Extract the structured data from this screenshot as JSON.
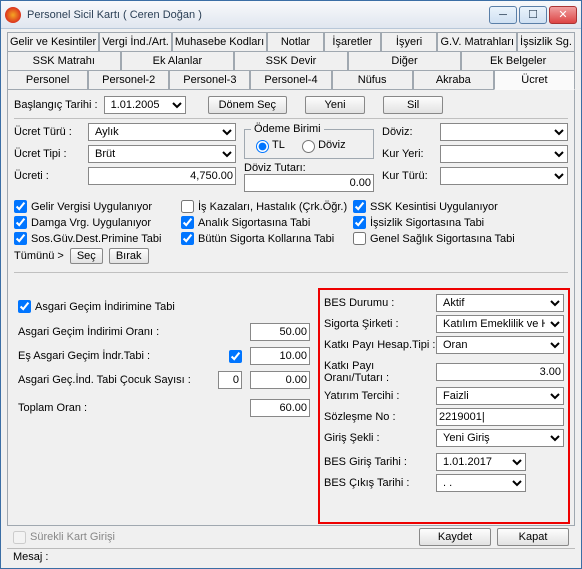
{
  "window": {
    "title": "Personel Sicil Kartı ( Ceren Doğan )"
  },
  "tabs": {
    "row1": [
      "Gelir ve Kesintiler",
      "Vergi İnd./Art.",
      "Muhasebe Kodları",
      "Notlar",
      "İşaretler",
      "İşyeri",
      "G.V. Matrahları",
      "İşsizlik Sg."
    ],
    "row2": [
      "SSK Matrahı",
      "Ek Alanlar",
      "SSK Devir",
      "Diğer",
      "Ek Belgeler"
    ],
    "row3": [
      "Personel",
      "Personel-2",
      "Personel-3",
      "Personel-4",
      "Nüfus",
      "Akraba",
      "Ücret"
    ]
  },
  "toprow": {
    "baslangic_label": "Başlangıç Tarihi :",
    "baslangic_value": "1.01.2005",
    "donem_sec": "Dönem Seç",
    "yeni": "Yeni",
    "sil": "Sil"
  },
  "ucret": {
    "turu_label": "Ücret Türü :",
    "turu_value": "Aylık",
    "tipi_label": "Ücret Tipi :",
    "tipi_value": "Brüt",
    "ucreti_label": "Ücreti :",
    "ucreti_value": "4,750.00",
    "odeme_legend": "Ödeme Birimi",
    "tl": "TL",
    "doviz": "Döviz",
    "doviz_tutari_label": "Döviz Tutarı:",
    "doviz_tutari_value": "0.00",
    "doviz_label": "Döviz:",
    "kur_yeri_label": "Kur Yeri:",
    "kur_turu_label": "Kur Türü:"
  },
  "checks": {
    "gelir_vergisi": "Gelir Vergisi Uygulanıyor",
    "is_kazalari": "İş Kazaları, Hastalık (Çrk.Öğr.)",
    "ssk_kesintisi": "SSK Kesintisi Uygulanıyor",
    "damga": "Damga Vrg. Uygulanıyor",
    "analik": "Analık Sigortasına Tabi",
    "issizlik": "İşsizlik Sigortasına Tabi",
    "sosguv": "Sos.Güv.Dest.Primine Tabi",
    "butun": "Bütün Sigorta Kollarına Tabi",
    "genel_saglik": "Genel Sağlık Sigortasına Tabi",
    "tumunu": "Tümünü >",
    "sec": "Seç",
    "birak": "Bırak"
  },
  "asgari": {
    "tabi": "Asgari Geçim İndirimine Tabi",
    "orani_label": "Asgari Geçim İndirimi Oranı :",
    "orani_value": "50.00",
    "es_label": "Eş Asgari Geçim İndr.Tabi :",
    "es_value": "10.00",
    "cocuk_label": "Asgari Geç.İnd. Tabi Çocuk Sayısı :",
    "cocuk_value": "0",
    "cocuk_oran": "0.00",
    "toplam_label": "Toplam Oran :",
    "toplam_value": "60.00"
  },
  "bes": {
    "durum_label": "BES Durumu :",
    "durum_value": "Aktif",
    "sirket_label": "Sigorta Şirketi :",
    "sirket_value": "Katılım Emeklilik ve Hayat",
    "hesap_label": "Katkı Payı Hesap.Tipi :",
    "hesap_value": "Oran",
    "oran_label": "Katkı Payı Oranı/Tutarı :",
    "oran_value": "3.00",
    "yatirim_label": "Yatırım Tercihi :",
    "yatirim_value": "Faizli",
    "sozlesme_label": "Sözleşme No :",
    "sozlesme_value": "2219001|",
    "giris_sekli_label": "Giriş Şekli :",
    "giris_sekli_value": "Yeni Giriş",
    "giris_tarih_label": "BES Giriş Tarihi :",
    "giris_tarih_value": "1.01.2017",
    "cikis_tarih_label": "BES Çıkış Tarihi :",
    "cikis_tarih_value": "  .  ."
  },
  "footer": {
    "surekli": "Sürekli Kart Girişi",
    "kaydet": "Kaydet",
    "kapat": "Kapat"
  },
  "mesaj_label": "Mesaj :"
}
